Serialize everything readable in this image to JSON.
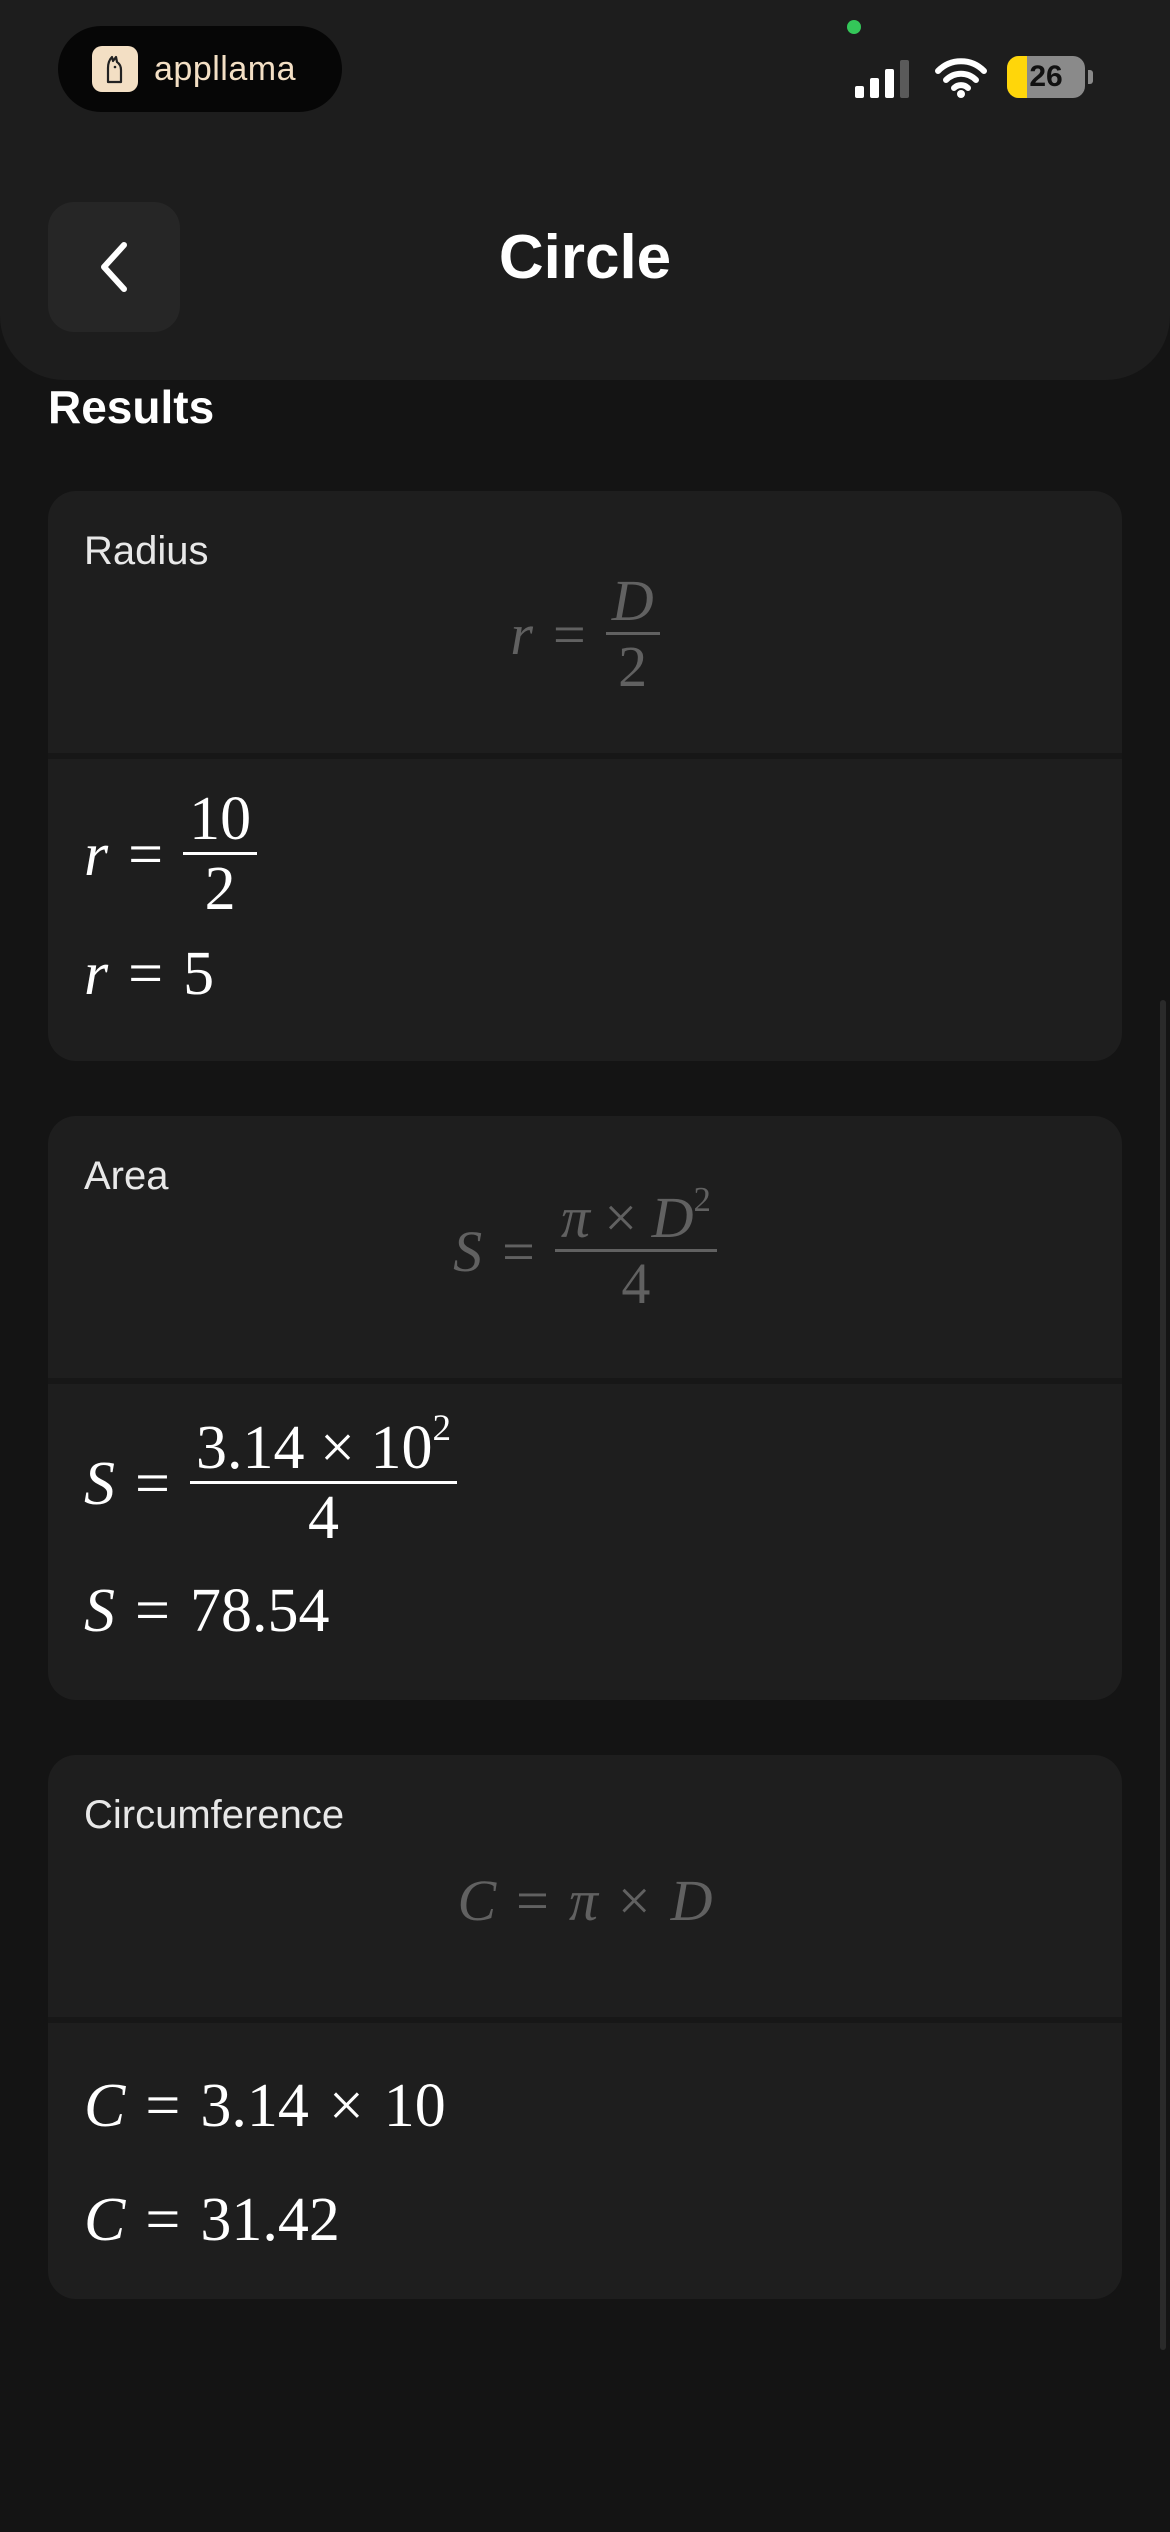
{
  "status_bar": {
    "app_name": "appllama",
    "battery_level": "26",
    "battery_fraction": 0.26
  },
  "header": {
    "title": "Circle",
    "back_icon": "chevron-left-icon"
  },
  "results": {
    "title": "Results",
    "cards": [
      {
        "label": "Radius",
        "formula": {
          "lhs": "r",
          "eq": "=",
          "num": "D",
          "den": "2"
        },
        "steps": [
          {
            "lhs": "r",
            "eq": "=",
            "num": "10",
            "den": "2"
          },
          {
            "lhs": "r",
            "eq": "=",
            "value": "5"
          }
        ]
      },
      {
        "label": "Area",
        "formula": {
          "lhs": "S",
          "eq": "=",
          "num_a": "π",
          "times": "×",
          "num_b": "D",
          "exp": "2",
          "den": "4"
        },
        "steps": [
          {
            "lhs": "S",
            "eq": "=",
            "num_a": "3.14",
            "times": "×",
            "num_b": "10",
            "exp": "2",
            "den": "4"
          },
          {
            "lhs": "S",
            "eq": "=",
            "value": "78.54"
          }
        ]
      },
      {
        "label": "Circumference",
        "formula": {
          "lhs": "C",
          "eq": "=",
          "a": "π",
          "times": "×",
          "b": "D"
        },
        "steps": [
          {
            "lhs": "C",
            "eq": "=",
            "a": "3.14",
            "times": "×",
            "b": "10"
          },
          {
            "lhs": "C",
            "eq": "=",
            "value": "31.42"
          }
        ]
      }
    ]
  },
  "colors": {
    "background": "#141414",
    "card": "#1e1e1e",
    "header": "#1d1d1d",
    "formula_gray": "#616161",
    "battery_yellow": "#ffd60a",
    "app_accent": "#f3dfc4"
  }
}
